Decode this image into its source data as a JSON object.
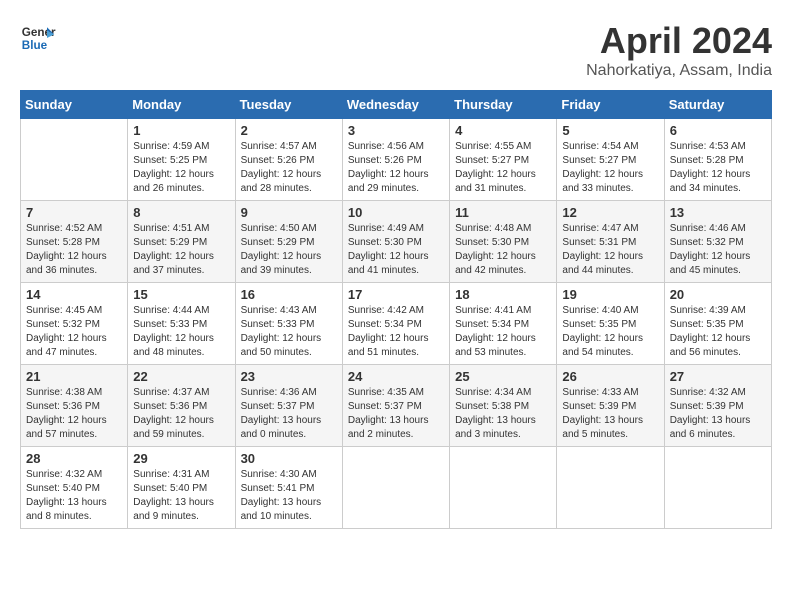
{
  "header": {
    "logo_line1": "General",
    "logo_line2": "Blue",
    "month": "April 2024",
    "location": "Nahorkatiya, Assam, India"
  },
  "weekdays": [
    "Sunday",
    "Monday",
    "Tuesday",
    "Wednesday",
    "Thursday",
    "Friday",
    "Saturday"
  ],
  "weeks": [
    [
      {
        "day": "",
        "info": ""
      },
      {
        "day": "1",
        "info": "Sunrise: 4:59 AM\nSunset: 5:25 PM\nDaylight: 12 hours\nand 26 minutes."
      },
      {
        "day": "2",
        "info": "Sunrise: 4:57 AM\nSunset: 5:26 PM\nDaylight: 12 hours\nand 28 minutes."
      },
      {
        "day": "3",
        "info": "Sunrise: 4:56 AM\nSunset: 5:26 PM\nDaylight: 12 hours\nand 29 minutes."
      },
      {
        "day": "4",
        "info": "Sunrise: 4:55 AM\nSunset: 5:27 PM\nDaylight: 12 hours\nand 31 minutes."
      },
      {
        "day": "5",
        "info": "Sunrise: 4:54 AM\nSunset: 5:27 PM\nDaylight: 12 hours\nand 33 minutes."
      },
      {
        "day": "6",
        "info": "Sunrise: 4:53 AM\nSunset: 5:28 PM\nDaylight: 12 hours\nand 34 minutes."
      }
    ],
    [
      {
        "day": "7",
        "info": "Sunrise: 4:52 AM\nSunset: 5:28 PM\nDaylight: 12 hours\nand 36 minutes."
      },
      {
        "day": "8",
        "info": "Sunrise: 4:51 AM\nSunset: 5:29 PM\nDaylight: 12 hours\nand 37 minutes."
      },
      {
        "day": "9",
        "info": "Sunrise: 4:50 AM\nSunset: 5:29 PM\nDaylight: 12 hours\nand 39 minutes."
      },
      {
        "day": "10",
        "info": "Sunrise: 4:49 AM\nSunset: 5:30 PM\nDaylight: 12 hours\nand 41 minutes."
      },
      {
        "day": "11",
        "info": "Sunrise: 4:48 AM\nSunset: 5:30 PM\nDaylight: 12 hours\nand 42 minutes."
      },
      {
        "day": "12",
        "info": "Sunrise: 4:47 AM\nSunset: 5:31 PM\nDaylight: 12 hours\nand 44 minutes."
      },
      {
        "day": "13",
        "info": "Sunrise: 4:46 AM\nSunset: 5:32 PM\nDaylight: 12 hours\nand 45 minutes."
      }
    ],
    [
      {
        "day": "14",
        "info": "Sunrise: 4:45 AM\nSunset: 5:32 PM\nDaylight: 12 hours\nand 47 minutes."
      },
      {
        "day": "15",
        "info": "Sunrise: 4:44 AM\nSunset: 5:33 PM\nDaylight: 12 hours\nand 48 minutes."
      },
      {
        "day": "16",
        "info": "Sunrise: 4:43 AM\nSunset: 5:33 PM\nDaylight: 12 hours\nand 50 minutes."
      },
      {
        "day": "17",
        "info": "Sunrise: 4:42 AM\nSunset: 5:34 PM\nDaylight: 12 hours\nand 51 minutes."
      },
      {
        "day": "18",
        "info": "Sunrise: 4:41 AM\nSunset: 5:34 PM\nDaylight: 12 hours\nand 53 minutes."
      },
      {
        "day": "19",
        "info": "Sunrise: 4:40 AM\nSunset: 5:35 PM\nDaylight: 12 hours\nand 54 minutes."
      },
      {
        "day": "20",
        "info": "Sunrise: 4:39 AM\nSunset: 5:35 PM\nDaylight: 12 hours\nand 56 minutes."
      }
    ],
    [
      {
        "day": "21",
        "info": "Sunrise: 4:38 AM\nSunset: 5:36 PM\nDaylight: 12 hours\nand 57 minutes."
      },
      {
        "day": "22",
        "info": "Sunrise: 4:37 AM\nSunset: 5:36 PM\nDaylight: 12 hours\nand 59 minutes."
      },
      {
        "day": "23",
        "info": "Sunrise: 4:36 AM\nSunset: 5:37 PM\nDaylight: 13 hours\nand 0 minutes."
      },
      {
        "day": "24",
        "info": "Sunrise: 4:35 AM\nSunset: 5:37 PM\nDaylight: 13 hours\nand 2 minutes."
      },
      {
        "day": "25",
        "info": "Sunrise: 4:34 AM\nSunset: 5:38 PM\nDaylight: 13 hours\nand 3 minutes."
      },
      {
        "day": "26",
        "info": "Sunrise: 4:33 AM\nSunset: 5:39 PM\nDaylight: 13 hours\nand 5 minutes."
      },
      {
        "day": "27",
        "info": "Sunrise: 4:32 AM\nSunset: 5:39 PM\nDaylight: 13 hours\nand 6 minutes."
      }
    ],
    [
      {
        "day": "28",
        "info": "Sunrise: 4:32 AM\nSunset: 5:40 PM\nDaylight: 13 hours\nand 8 minutes."
      },
      {
        "day": "29",
        "info": "Sunrise: 4:31 AM\nSunset: 5:40 PM\nDaylight: 13 hours\nand 9 minutes."
      },
      {
        "day": "30",
        "info": "Sunrise: 4:30 AM\nSunset: 5:41 PM\nDaylight: 13 hours\nand 10 minutes."
      },
      {
        "day": "",
        "info": ""
      },
      {
        "day": "",
        "info": ""
      },
      {
        "day": "",
        "info": ""
      },
      {
        "day": "",
        "info": ""
      }
    ]
  ]
}
